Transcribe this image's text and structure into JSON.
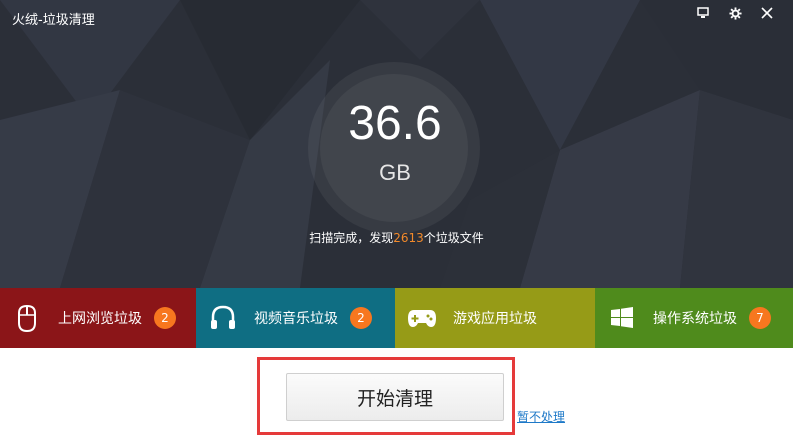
{
  "window": {
    "title": "火绒-垃圾清理",
    "controls": [
      "feedback-icon",
      "gear-icon",
      "close-icon"
    ]
  },
  "summary": {
    "size_value": "36.6",
    "size_unit": "GB",
    "status_prefix": "扫描完成，发现",
    "file_count": "2613",
    "status_suffix": "个垃圾文件"
  },
  "categories": [
    {
      "label": "上网浏览垃圾",
      "badge": "2",
      "icon": "mouse-icon",
      "color": "#8b1518"
    },
    {
      "label": "视频音乐垃圾",
      "badge": "2",
      "icon": "headphones-icon",
      "color": "#0f6e83"
    },
    {
      "label": "游戏应用垃圾",
      "badge": "",
      "icon": "gamepad-icon",
      "color": "#969b17"
    },
    {
      "label": "操作系统垃圾",
      "badge": "7",
      "icon": "windows-logo-icon",
      "color": "#4f8b1c"
    }
  ],
  "actions": {
    "start_label": "开始清理",
    "skip_label": "暂不处理"
  },
  "colors": {
    "accent_orange": "#f28a2b",
    "badge": "#f7771f",
    "highlight": "#e53a3a",
    "link": "#1e79c8"
  }
}
